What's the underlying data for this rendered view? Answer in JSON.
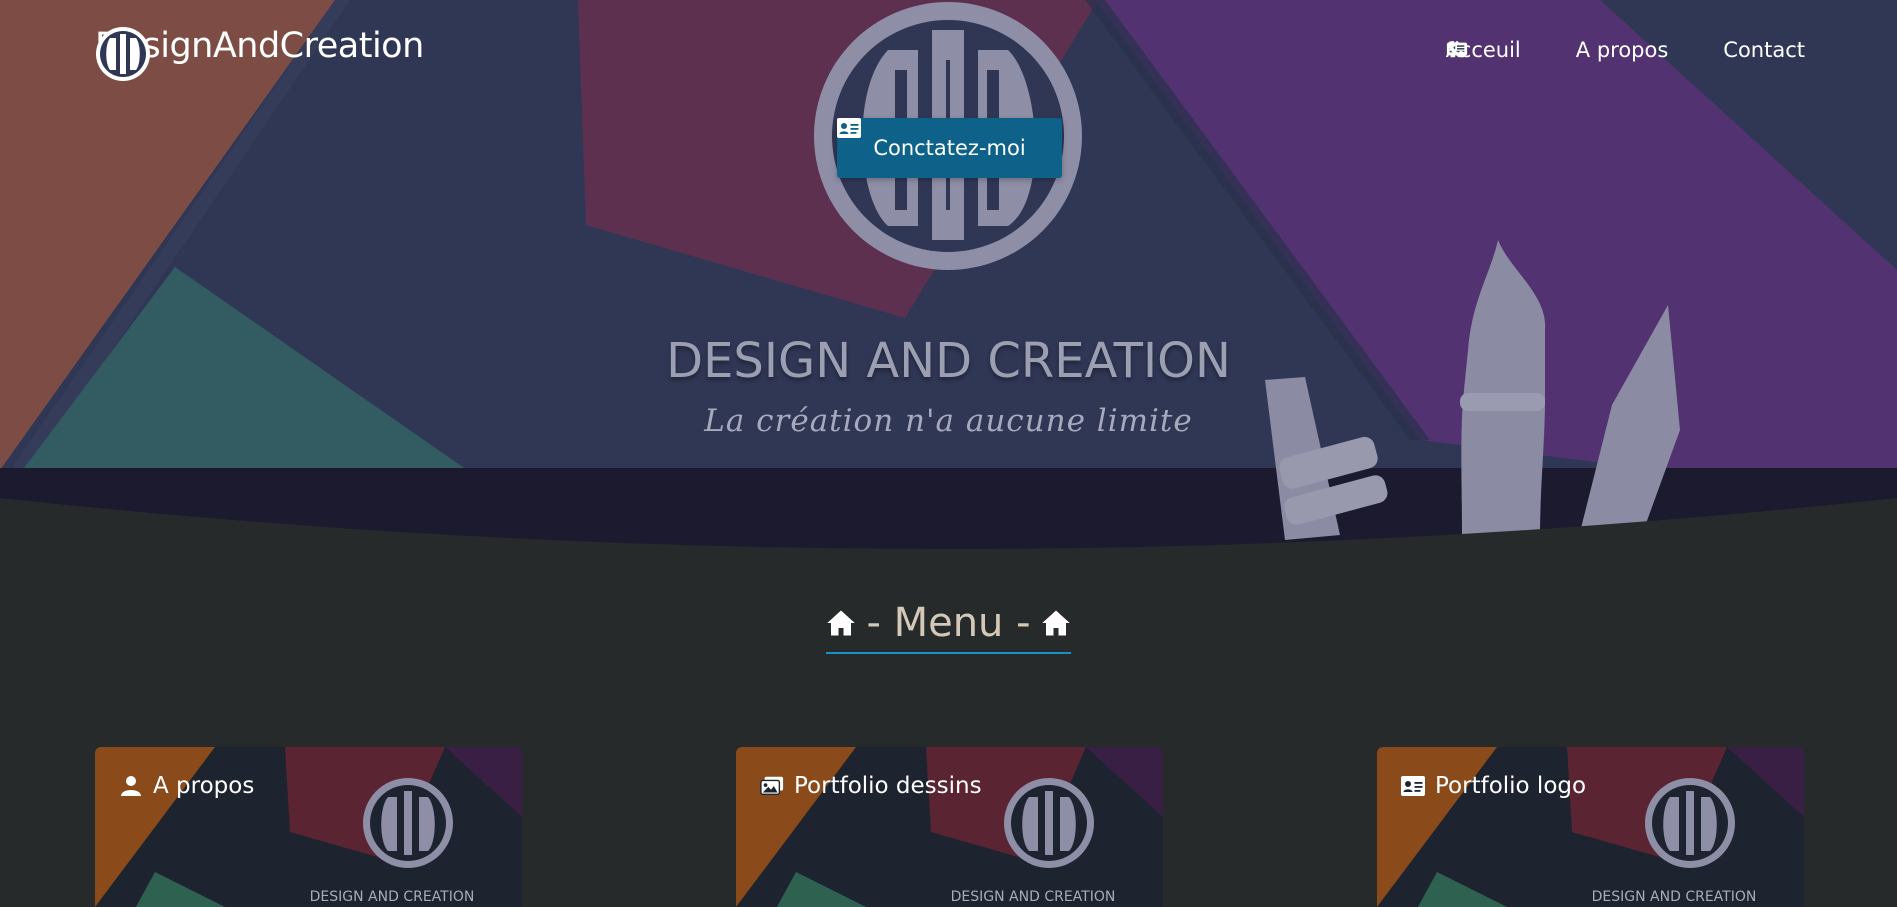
{
  "navbar": {
    "brand_name": "DesignAndCreation",
    "links": [
      {
        "label": "Acceuil",
        "icon": "home-icon"
      },
      {
        "label": "A propos",
        "icon": "newspaper-icon"
      },
      {
        "label": "Contact",
        "icon": "phone-icon"
      }
    ]
  },
  "hero": {
    "contact_button_label": "Conctatez-moi",
    "contact_button_icon": "id-card-icon",
    "title": "DESIGN AND CREATION",
    "subtitle": "La création n'a aucune limite"
  },
  "menu": {
    "heading": "- Menu -",
    "heading_icon": "home-icon",
    "accent_color": "#1d8fc7"
  },
  "cards": [
    {
      "title": "A propos",
      "icon": "user-icon",
      "caption": "DESIGN AND CREATION"
    },
    {
      "title": "Portfolio dessins",
      "icon": "images-icon",
      "caption": "DESIGN AND CREATION"
    },
    {
      "title": "Portfolio logo",
      "icon": "id-card-icon",
      "caption": "DESIGN AND CREATION"
    }
  ],
  "colors": {
    "page_background": "#262a2a",
    "button_background": "#0e6189",
    "hero_navy": "#2f3755",
    "hero_purple": "#523270",
    "hero_maroon": "#5e3050",
    "hero_teal": "#335b62",
    "hero_rust": "#7d4d45"
  }
}
